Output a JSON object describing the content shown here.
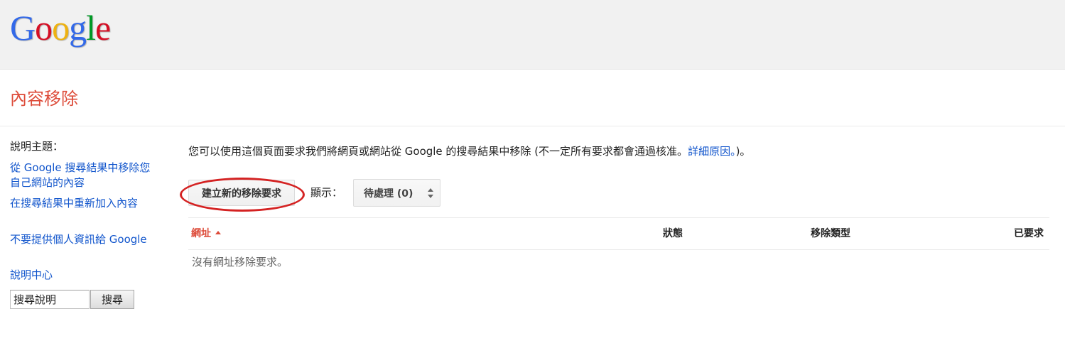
{
  "header": {
    "logo_letters": [
      {
        "char": "G",
        "color": "#3369e8"
      },
      {
        "char": "o",
        "color": "#d50f25"
      },
      {
        "char": "o",
        "color": "#eeb211"
      },
      {
        "char": "g",
        "color": "#3369e8"
      },
      {
        "char": "l",
        "color": "#009925"
      },
      {
        "char": "e",
        "color": "#d50f25"
      }
    ]
  },
  "page": {
    "title": "內容移除"
  },
  "sidebar": {
    "heading": "說明主題：",
    "links": [
      "從 Google 搜尋結果中移除您自己網站的內容",
      "在搜尋結果中重新加入內容",
      "不要提供個人資訊給 Google",
      "說明中心"
    ],
    "search_value": "搜尋說明",
    "search_button": "搜尋"
  },
  "main": {
    "intro_text": "您可以使用這個頁面要求我們將網頁或網站從 Google 的搜尋結果中移除 (不一定所有要求都會通過核准。",
    "intro_link": "詳細原因。",
    "intro_end": ")。",
    "create_button": "建立新的移除要求",
    "show_label": "顯示：",
    "filter_selected": "待處理 (0)",
    "table": {
      "columns": [
        "網址",
        "狀態",
        "移除類型",
        "已要求"
      ],
      "empty_message": "沒有網址移除要求。"
    }
  },
  "colors": {
    "accent": "#dd4b39",
    "link": "#1155cc",
    "highlight_circle": "#d42222"
  }
}
